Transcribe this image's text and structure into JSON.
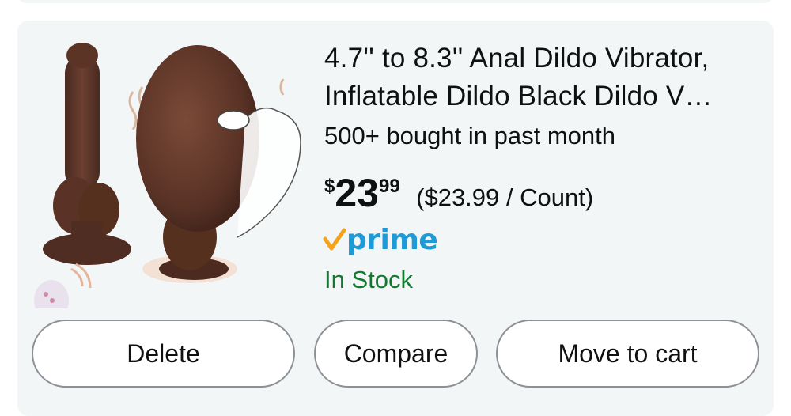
{
  "product": {
    "title_line1": "4.7'' to 8.3'' Anal Dildo Vibrator,",
    "title_line2": "Inflatable Dildo Black Dildo V…",
    "bought": "500+ bought in past month",
    "price": {
      "currency": "$",
      "whole": "23",
      "fraction": "99",
      "unit_price": "($23.99 / Count)"
    },
    "prime": "prime",
    "stock": "In Stock",
    "image_icon": "product-photo"
  },
  "actions": {
    "delete": "Delete",
    "compare": "Compare",
    "move_to_cart": "Move to cart"
  },
  "colors": {
    "card_bg": "#f3f6f7",
    "prime_blue": "#1e9bd6",
    "prime_check": "#f7a21b",
    "stock_green": "#117a2f",
    "button_border": "#8d9096"
  }
}
